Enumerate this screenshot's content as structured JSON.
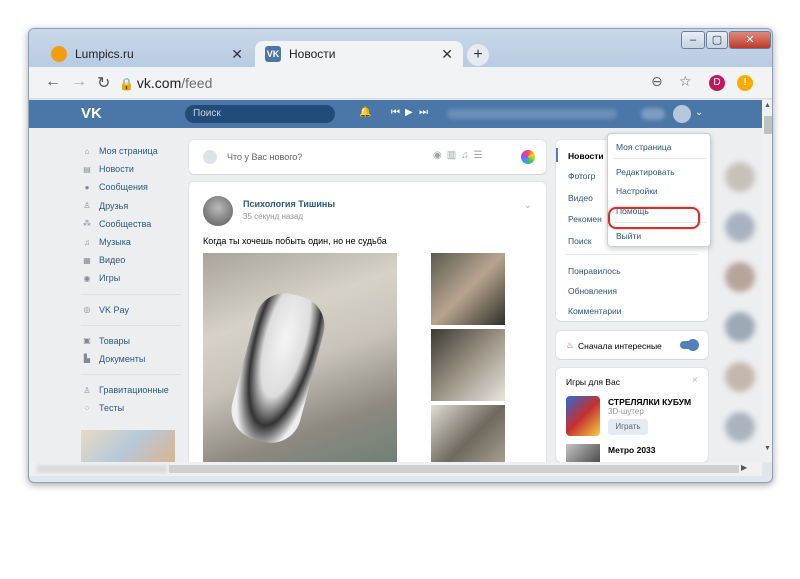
{
  "browser": {
    "tabs": [
      {
        "label": "Lumpics.ru",
        "favicon": "lumpics-favicon",
        "active": false
      },
      {
        "label": "Новости",
        "favicon": "vk-favicon",
        "active": true
      }
    ],
    "tab_close_glyph": "✕",
    "new_tab_glyph": "+",
    "url_host": "vk.com",
    "url_path": "/feed",
    "profile_initial": "D",
    "warning_glyph": "!",
    "controls": {
      "minimize": "–",
      "maximize": "▢",
      "close": "✕"
    }
  },
  "vk": {
    "logo": "VK",
    "search_placeholder": "Поиск",
    "nav": [
      {
        "label": "Моя страница",
        "icon": "home-icon"
      },
      {
        "label": "Новости",
        "icon": "news-icon"
      },
      {
        "label": "Сообщения",
        "icon": "messages-icon"
      },
      {
        "label": "Друзья",
        "icon": "friends-icon"
      },
      {
        "label": "Сообщества",
        "icon": "groups-icon"
      },
      {
        "label": "Музыка",
        "icon": "music-icon"
      },
      {
        "label": "Видео",
        "icon": "video-icon"
      },
      {
        "label": "Игры",
        "icon": "games-icon"
      },
      {
        "label": "VK Pay",
        "icon": "vkpay-icon"
      },
      {
        "label": "Товары",
        "icon": "market-icon"
      },
      {
        "label": "Документы",
        "icon": "documents-icon"
      },
      {
        "label": "Гравитационные",
        "icon": "person-icon"
      },
      {
        "label": "Тесты",
        "icon": "apps-icon"
      }
    ],
    "composer_placeholder": "Что у Вас нового?",
    "post": {
      "author": "Психология Тишины",
      "time": "35 секунд назад",
      "text": "Когда ты хочешь побыть один, но не судьба"
    },
    "right_menu": {
      "items": [
        "Новости",
        "Фотогр",
        "Видео",
        "Рекомен",
        "Поиск"
      ],
      "items2": [
        "Понравилось",
        "Обновления",
        "Комментарии"
      ]
    },
    "interesting_first": "Сначала интересные",
    "games": {
      "header": "Игры для Вас",
      "g1_name": "СТРЕЛЯЛКИ КУБУМ",
      "g1_genre": "3D-шутер",
      "play": "Играть",
      "g2_name": "Метро 2033"
    },
    "dropdown": [
      "Моя страница",
      "Редактировать",
      "Настройки",
      "Помощь",
      "Выйти"
    ]
  },
  "colors": {
    "vk_blue": "#4a76a8",
    "link": "#2a5885",
    "highlight": "#d32f2f"
  }
}
